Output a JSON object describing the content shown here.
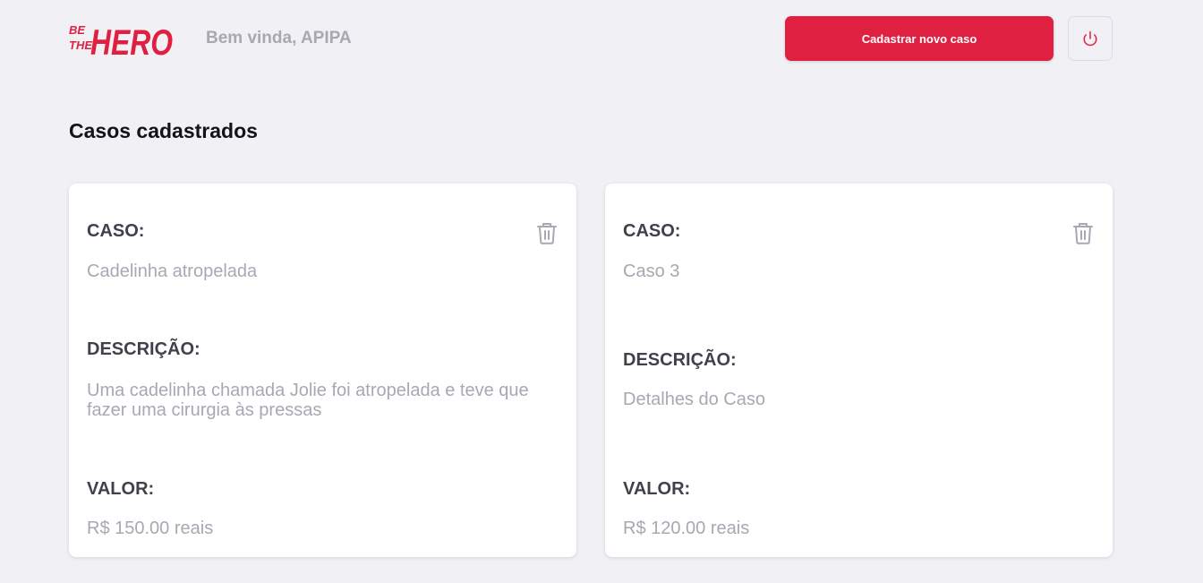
{
  "header": {
    "logo": {
      "text": "BE THE HERO",
      "line1": "BE",
      "line2": "THE",
      "word": "HERO"
    },
    "welcome": "Bem vinda, APIPA",
    "new_case_button": "Cadastrar novo caso",
    "power_icon": "power-icon"
  },
  "page_title": "Casos cadastrados",
  "cases": [
    {
      "case_label": "CASO:",
      "case_value": "Cadelinha atropelada",
      "description_label": "DESCRIÇÃO:",
      "description_value": "Uma cadelinha chamada Jolie foi atropelada e teve que fazer uma cirurgia às pressas",
      "value_label": "VALOR:",
      "value_value": "R$ 150.00 reais"
    },
    {
      "case_label": "CASO:",
      "case_value": "Caso 3",
      "description_label": "DESCRIÇÃO:",
      "description_value": "Detalhes do Caso",
      "value_label": "VALOR:",
      "value_value": "R$ 120.00 reais"
    }
  ],
  "colors": {
    "accent": "#e02041",
    "background": "#f0f0f5",
    "muted_text": "#a8a8b3",
    "label_text": "#41414d"
  }
}
